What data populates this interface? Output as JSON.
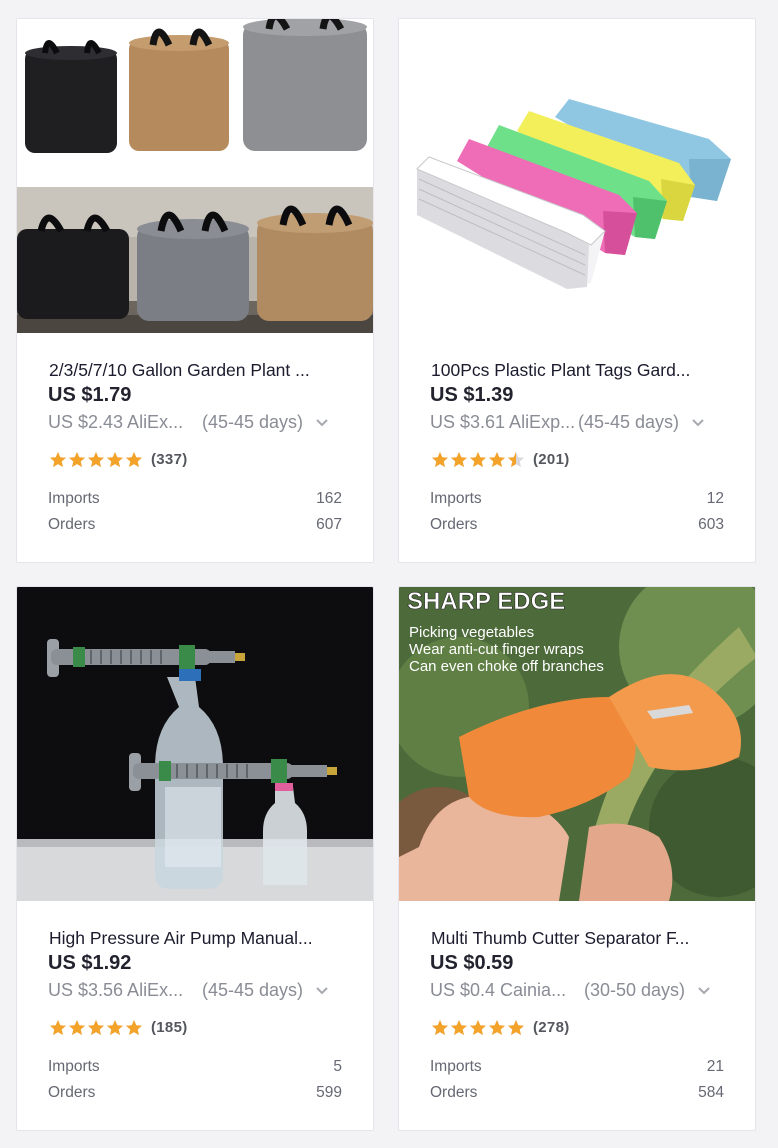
{
  "products": [
    {
      "title": "2/3/5/7/10 Gallon Garden Plant ...",
      "price": "US $1.79",
      "compare_price": "US $2.43 AliEx...",
      "shipping_time": "(45-45 days)",
      "rating": 5,
      "reviews": "(337)",
      "imports_label": "Imports",
      "imports": "162",
      "orders_label": "Orders",
      "orders": "607",
      "image_icon": "grow-bags-image"
    },
    {
      "title": "100Pcs Plastic Plant Tags Gard...",
      "price": "US $1.39",
      "compare_price": "US $3.61 AliExp...",
      "shipping_time": "(45-45 days)",
      "rating": 4.5,
      "reviews": "(201)",
      "imports_label": "Imports",
      "imports": "12",
      "orders_label": "Orders",
      "orders": "603",
      "image_icon": "plant-tags-image"
    },
    {
      "title": "High Pressure Air Pump Manual...",
      "price": "US $1.92",
      "compare_price": "US $3.56 AliEx...",
      "shipping_time": "(45-45 days)",
      "rating": 5,
      "reviews": "(185)",
      "imports_label": "Imports",
      "imports": "5",
      "orders_label": "Orders",
      "orders": "599",
      "image_icon": "air-pump-sprayer-image"
    },
    {
      "title": "Multi Thumb Cutter Separator F...",
      "price": "US $0.59",
      "compare_price": "US $0.4 Cainia...",
      "shipping_time": "(30-50 days)",
      "rating": 5,
      "reviews": "(278)",
      "imports_label": "Imports",
      "imports": "21",
      "orders_label": "Orders",
      "orders": "584",
      "image_icon": "thumb-cutter-image",
      "image_text": {
        "headline": "SHARP EDGE",
        "line1": "Picking vegetables",
        "line2": "Wear anti-cut finger wraps",
        "line3": "Can even choke off branches"
      }
    }
  ],
  "colors": {
    "star": "#f4a32a",
    "star_empty": "#d8d8de",
    "page_bg": "#f3f3f6",
    "card_border": "#e4e4ea"
  }
}
